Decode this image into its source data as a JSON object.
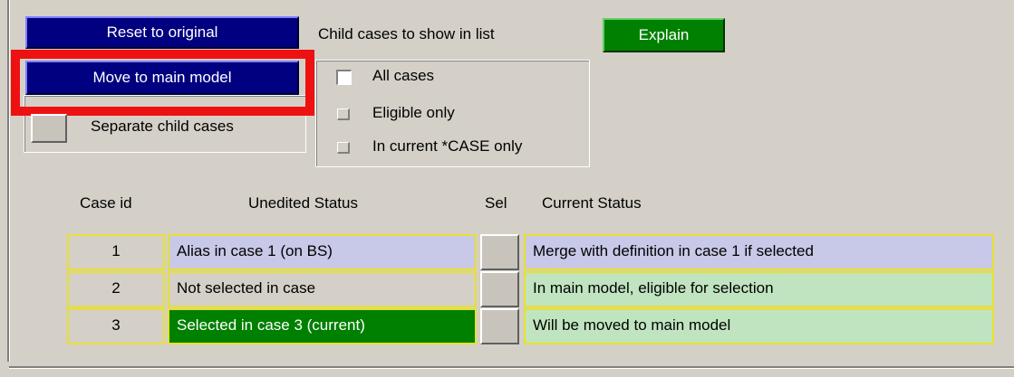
{
  "top_buttons": {
    "reset_label": "Reset to original",
    "move_label": "Move to main model",
    "separate_label": "Separate child cases"
  },
  "child_cases": {
    "title": "Child cases to show in list",
    "explain_label": "Explain",
    "options": [
      {
        "label": "All cases",
        "selected": true
      },
      {
        "label": "Eligible only",
        "selected": false
      },
      {
        "label": "In current *CASE only",
        "selected": false
      }
    ]
  },
  "table": {
    "headers": {
      "case_id": "Case id",
      "unedited": "Unedited Status",
      "sel": "Sel",
      "current": "Current Status"
    },
    "rows": [
      {
        "case_id": "1",
        "unedited": "Alias in case 1 (on BS)",
        "current": "Merge with definition in case 1 if selected"
      },
      {
        "case_id": "2",
        "unedited": "Not selected in case",
        "current": "In main model, eligible for selection"
      },
      {
        "case_id": "3",
        "unedited": "Selected in case 3 (current)",
        "current": "Will be moved to main model"
      }
    ]
  },
  "colors": {
    "panel_bg": "#d4d0c8",
    "button_blue": "#000080",
    "button_green": "#008000",
    "highlight_red": "#ee1111",
    "cell_lavender": "#c8c8e8",
    "cell_mint": "#c0e4c0",
    "cell_green": "#008000",
    "cell_border_yellow": "#e8e030"
  }
}
